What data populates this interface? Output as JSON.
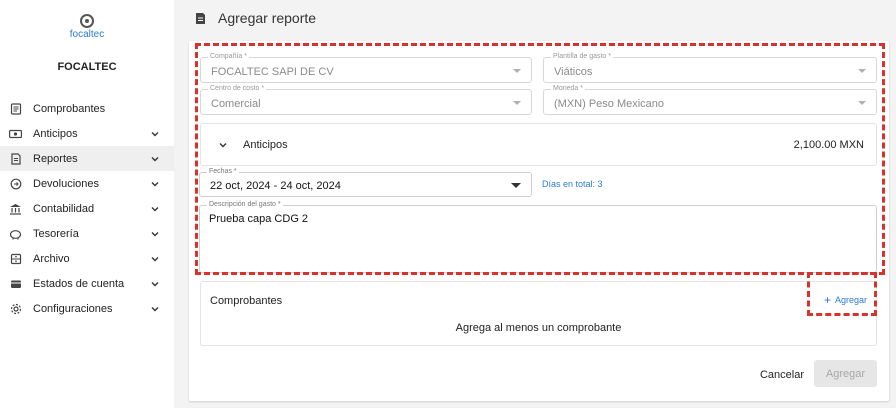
{
  "brand": {
    "logo_text": "focaltec",
    "company": "FOCALTEC"
  },
  "sidebar": {
    "items": [
      {
        "label": "Comprobantes",
        "icon": "receipt-icon",
        "chevron": false
      },
      {
        "label": "Anticipos",
        "icon": "cash-icon",
        "chevron": true
      },
      {
        "label": "Reportes",
        "icon": "report-icon",
        "chevron": true,
        "active": true
      },
      {
        "label": "Devoluciones",
        "icon": "refund-icon",
        "chevron": true
      },
      {
        "label": "Contabilidad",
        "icon": "bank-icon",
        "chevron": true
      },
      {
        "label": "Tesorería",
        "icon": "piggy-bank-icon",
        "chevron": true
      },
      {
        "label": "Archivo",
        "icon": "archive-icon",
        "chevron": true
      },
      {
        "label": "Estados de cuenta",
        "icon": "wallet-icon",
        "chevron": true
      },
      {
        "label": "Configuraciones",
        "icon": "gear-icon",
        "chevron": true
      }
    ]
  },
  "header": {
    "title": "Agregar reporte",
    "icon": "document-icon"
  },
  "form": {
    "compania": {
      "label": "Compañía *",
      "value": "FOCALTEC SAPI DE CV"
    },
    "plantilla": {
      "label": "Plantilla de gasto *",
      "value": "Viáticos"
    },
    "centro": {
      "label": "Centro de costo *",
      "value": "Comercial"
    },
    "moneda": {
      "label": "Moneda *",
      "value": "(MXN) Peso Mexicano"
    },
    "anticipos": {
      "label": "Anticipos",
      "amount": "2,100.00 MXN"
    },
    "fechas": {
      "label": "Fechas *",
      "value": "22 oct, 2024 - 24 oct, 2024"
    },
    "dias_total": "Días en total: 3",
    "descripcion": {
      "label": "Descripción del gasto *",
      "value": "Prueba capa CDG 2"
    }
  },
  "comprobantes": {
    "title": "Comprobantes",
    "add_label": "Agregar",
    "empty_message": "Agrega al menos un comprobante"
  },
  "actions": {
    "cancel": "Cancelar",
    "submit": "Agregar"
  },
  "colors": {
    "accent": "#2c7bd1",
    "highlight": "#d9322c"
  }
}
